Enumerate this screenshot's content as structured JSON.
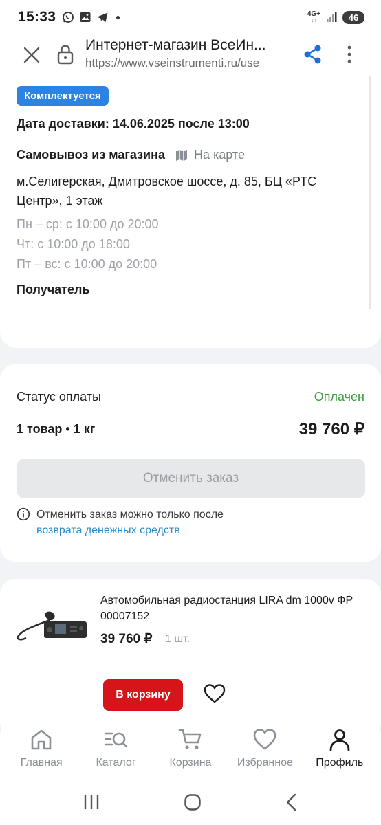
{
  "statusbar": {
    "time": "15:33",
    "network": "4G+",
    "battery": "46"
  },
  "browser": {
    "title": "Интернет-магазин ВсеИн...",
    "url": "https://www.vseinstrumenti.ru/use"
  },
  "order": {
    "status_badge": "Комплектуется",
    "delivery_date": "Дата доставки: 14.06.2025 после 13:00",
    "pickup_title": "Самовывоз из магазина",
    "map_link": "На карте",
    "address": "м.Селигерская, Дмитровское шоссе, д. 85, БЦ «РТС Центр», 1 этаж",
    "hours": [
      "Пн – ср: с 10:00 до 20:00",
      "Чт: с 10:00 до 18:00",
      "Пт – вс: с 10:00 до 20:00"
    ],
    "recipient_label": "Получатель"
  },
  "payment": {
    "label": "Статус оплаты",
    "status": "Оплачен",
    "status_color": "#3d9a3d",
    "items_summary": "1 товар • 1 кг",
    "total": "39 760 ₽",
    "cancel_button": "Отменить заказ",
    "info_text": "Отменить заказ можно только после",
    "info_link": "возврата денежных средств"
  },
  "product": {
    "name": "Автомобильная радиостанция LIRA dm 1000v ФР 00007152",
    "price": "39 760 ₽",
    "qty": "1 шт.",
    "cart_button": "В корзину",
    "cart_button_color": "#d8141b"
  },
  "nav": {
    "items": [
      {
        "label": "Главная",
        "icon": "home-icon"
      },
      {
        "label": "Каталог",
        "icon": "catalog-search-icon"
      },
      {
        "label": "Корзина",
        "icon": "cart-icon"
      },
      {
        "label": "Избранное",
        "icon": "heart-icon"
      },
      {
        "label": "Профиль",
        "icon": "profile-icon"
      }
    ],
    "active": "Профиль"
  },
  "colors": {
    "badge": "#2d83e1",
    "link": "#2b8ac8",
    "accent_red": "#d8141b"
  }
}
